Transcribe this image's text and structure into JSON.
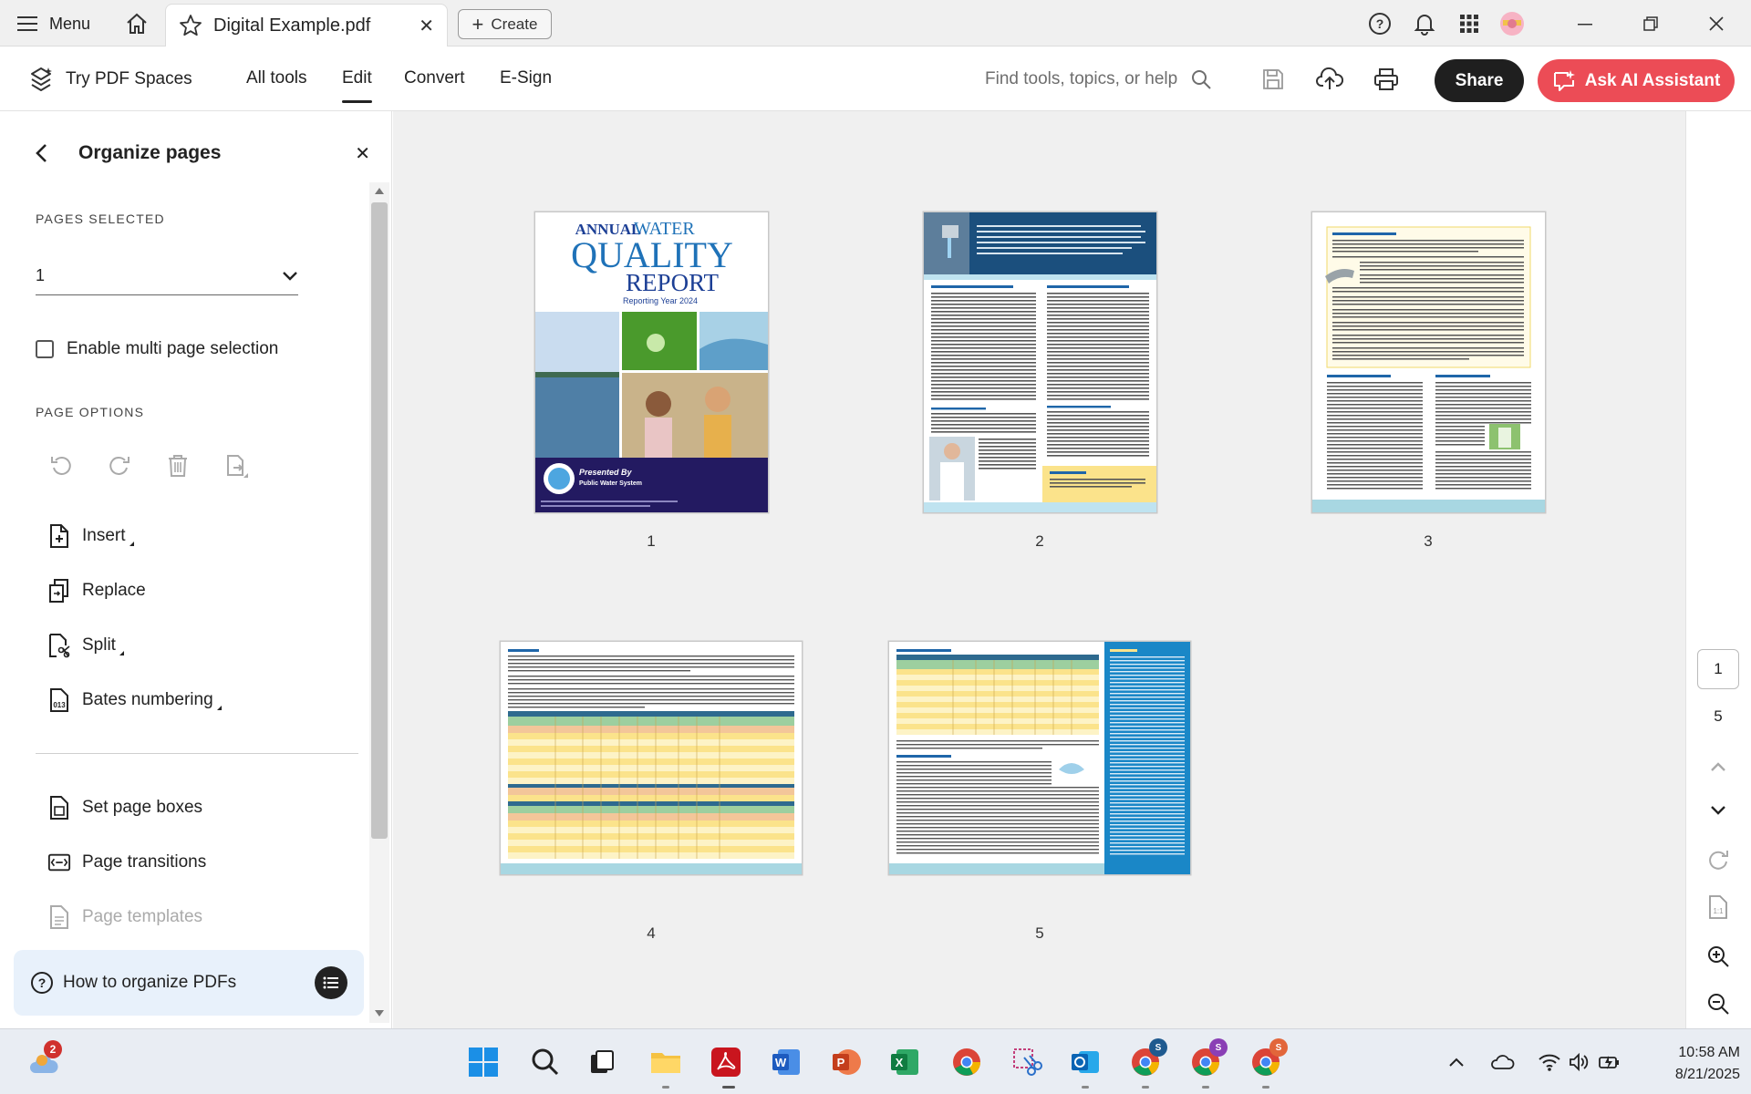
{
  "tabbar": {
    "menu_label": "Menu",
    "tab_title": "Digital Example.pdf",
    "create_label": "Create"
  },
  "toolbar": {
    "try_spaces": "Try PDF Spaces",
    "nav": [
      "All tools",
      "Edit",
      "Convert",
      "E-Sign"
    ],
    "active_nav": "Edit",
    "search_placeholder": "Find tools, topics, or help",
    "share_label": "Share",
    "ai_label": "Ask AI Assistant",
    "accent_red": "#ec4c56"
  },
  "panel": {
    "title": "Organize pages",
    "pages_selected_label": "PAGES SELECTED",
    "pages_selected_value": "1",
    "multi_select_label": "Enable multi page selection",
    "page_options_label": "PAGE OPTIONS",
    "tools": {
      "insert": "Insert",
      "replace": "Replace",
      "split": "Split",
      "bates": "Bates numbering",
      "page_boxes": "Set page boxes",
      "transitions": "Page transitions",
      "templates": "Page templates"
    },
    "help_label": "How to organize PDFs"
  },
  "pages": {
    "p1": "1",
    "p2": "2",
    "p3": "3",
    "p4": "4",
    "p5": "5",
    "cover": {
      "annual": "ANNUAL",
      "water": "WATER",
      "quality": "QUALITY",
      "report": "REPORT",
      "year": "Reporting Year 2024",
      "presented": "Presented By",
      "system": "Public Water System"
    }
  },
  "rail": {
    "current_page": "1",
    "total_pages": "5"
  },
  "taskbar": {
    "time": "10:58 AM",
    "date": "8/21/2025",
    "weather_badge": "2"
  }
}
